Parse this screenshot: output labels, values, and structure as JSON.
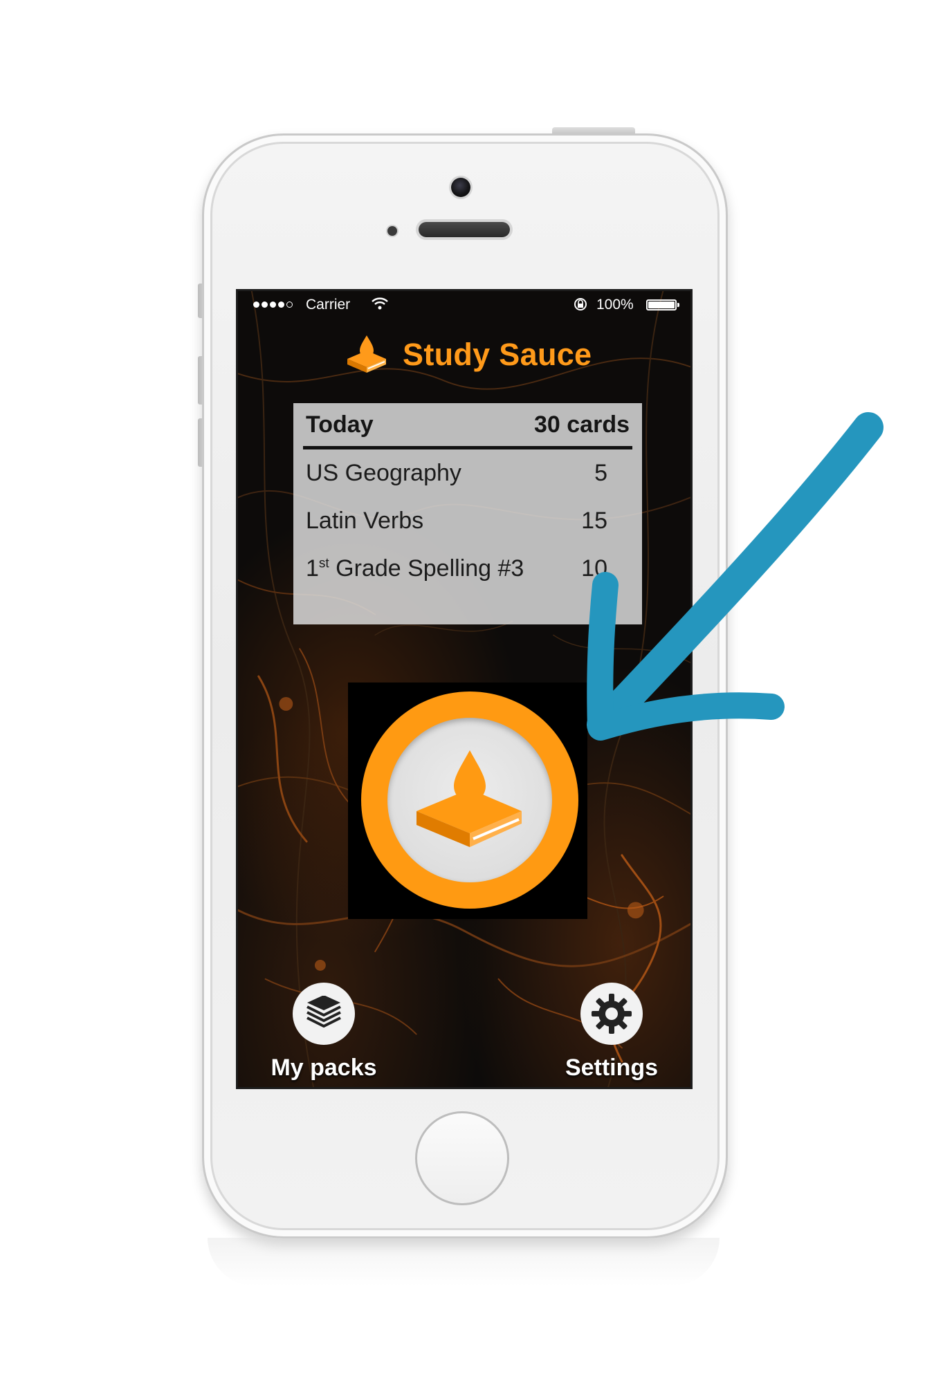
{
  "statusbar": {
    "carrier": "Carrier",
    "battery": "100%",
    "signal_bars": 5
  },
  "app": {
    "title": "Study Sauce",
    "accent": "#ff9a1a",
    "logo_icon": "sauce-book-icon"
  },
  "today": {
    "label": "Today",
    "total": "30 cards",
    "packs": [
      {
        "name_prefix": "",
        "name_sup": "",
        "name": "US Geography",
        "count": "5"
      },
      {
        "name_prefix": "",
        "name_sup": "",
        "name": "Latin Verbs",
        "count": "15"
      },
      {
        "name_prefix": "1",
        "name_sup": "st",
        "name": " Grade Spelling #3",
        "count": "10"
      }
    ]
  },
  "study_button": {
    "icon": "sauce-book-icon",
    "ring_color": "#ff9a12"
  },
  "nav": {
    "my_packs": {
      "label": "My packs",
      "icon": "stack-icon"
    },
    "settings": {
      "label": "Settings",
      "icon": "gear-icon"
    }
  },
  "annotation": {
    "arrow_color": "#2596be",
    "icon": "pointer-arrow-icon"
  }
}
